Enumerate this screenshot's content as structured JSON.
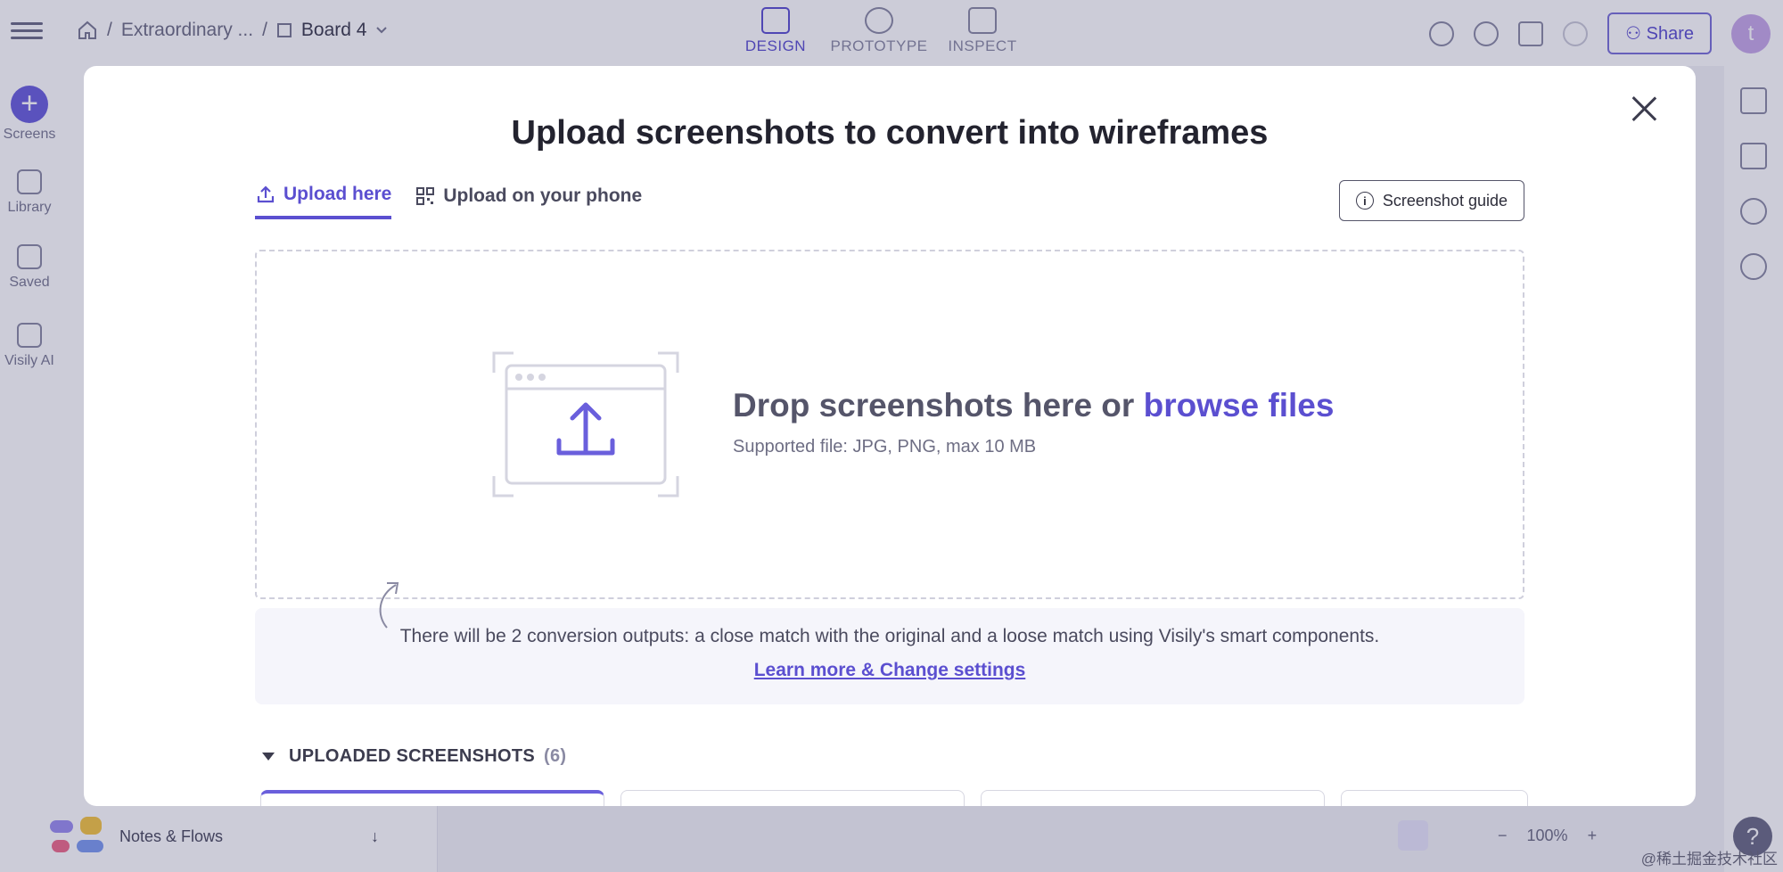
{
  "app": {
    "breadcrumb": {
      "project": "Extraordinary ...",
      "board": "Board 4",
      "separator": "/"
    },
    "modes": [
      {
        "label": "DESIGN",
        "active": true
      },
      {
        "label": "PROTOTYPE",
        "active": false
      },
      {
        "label": "INSPECT",
        "active": false
      }
    ],
    "share_label": "Share",
    "avatar_initial": "t",
    "left_rail": [
      {
        "label": "Screens"
      },
      {
        "label": "Library"
      },
      {
        "label": "Saved"
      },
      {
        "label": "Visily AI"
      }
    ],
    "notes_label": "Notes & Flows",
    "zoom": "100%",
    "zoom_out": "−",
    "zoom_in": "+",
    "help": "?",
    "watermark": "@稀土掘金技术社区",
    "colors": {
      "accent": "#5b4fd0",
      "overlay": "rgba(40,40,90,0.24)"
    }
  },
  "modal": {
    "title": "Upload screenshots to convert into wireframes",
    "tabs": [
      {
        "label": "Upload here",
        "icon": "upload-icon",
        "active": true
      },
      {
        "label": "Upload on your phone",
        "icon": "qr-code-icon",
        "active": false
      }
    ],
    "guide_button": {
      "label": "Screenshot guide",
      "icon": "info-icon"
    },
    "dropzone": {
      "heading_prefix": "Drop screenshots here or ",
      "browse_link": "browse files",
      "supported": "Supported file: JPG, PNG, max 10 MB"
    },
    "info": {
      "text": "There will be 2 conversion outputs: a close match with the original and a loose match using Visily's smart components.",
      "link": "Learn more & Change settings"
    },
    "uploaded": {
      "label": "UPLOADED SCREENSHOTS",
      "count": "(6)"
    }
  }
}
